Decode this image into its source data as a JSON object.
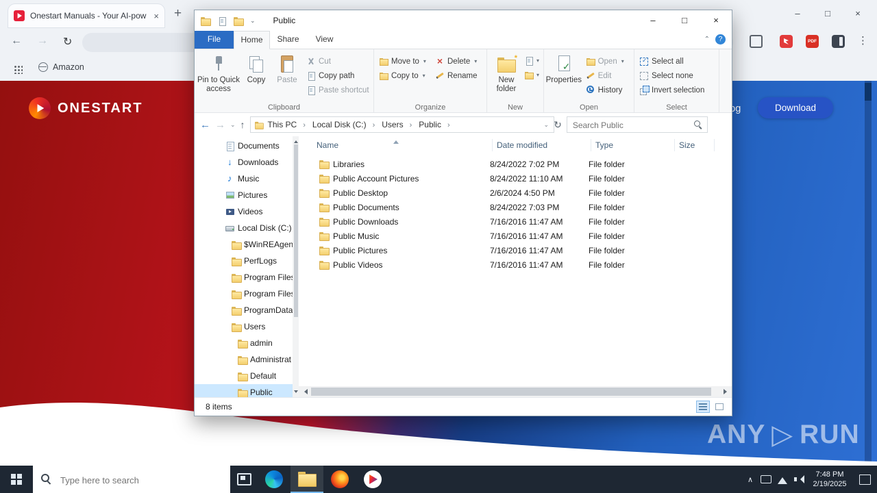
{
  "glyphs": {
    "close": "×",
    "min": "–",
    "max": "□",
    "plus": "+",
    "back": "←",
    "forward": "→",
    "refresh": "↻",
    "up": "↑",
    "caret_down": "⌄",
    "chevron_up": "⌃",
    "help": "?",
    "kebab": "⋮",
    "tray_chevron": "∧"
  },
  "browser": {
    "tab_title": "Onestart Manuals - Your AI-pow",
    "bookmark": "Amazon",
    "pdf_badge": "PDF"
  },
  "page": {
    "brand": "ONESTART",
    "nav_partial": "log",
    "download": "Download",
    "watermark_left": "ANY",
    "watermark_tri": "▷",
    "watermark_right": "RUN"
  },
  "explorer": {
    "title": "Public",
    "tabs": {
      "file": "File",
      "home": "Home",
      "share": "Share",
      "view": "View"
    },
    "ribbon": {
      "clipboard": {
        "label": "Clipboard",
        "pin": "Pin to Quick access",
        "copy": "Copy",
        "paste": "Paste",
        "cut": "Cut",
        "copy_path": "Copy path",
        "paste_shortcut": "Paste shortcut"
      },
      "organize": {
        "label": "Organize",
        "move_to": "Move to",
        "copy_to": "Copy to",
        "delete": "Delete",
        "rename": "Rename"
      },
      "new_group": {
        "label": "New",
        "new_folder": "New folder"
      },
      "open_group": {
        "label": "Open",
        "properties": "Properties",
        "open": "Open",
        "edit": "Edit",
        "history": "History"
      },
      "select_group": {
        "label": "Select",
        "all": "Select all",
        "none": "Select none",
        "invert": "Invert selection"
      }
    },
    "address": {
      "crumbs": [
        "This PC",
        "Local Disk (C:)",
        "Users",
        "Public"
      ],
      "search_placeholder": "Search Public"
    },
    "columns": [
      "Name",
      "Date modified",
      "Type",
      "Size"
    ],
    "nav": [
      {
        "label": "Documents",
        "icon": "doc",
        "lvl": 1
      },
      {
        "label": "Downloads",
        "icon": "down",
        "lvl": 1
      },
      {
        "label": "Music",
        "icon": "music",
        "lvl": 1
      },
      {
        "label": "Pictures",
        "icon": "pic",
        "lvl": 1
      },
      {
        "label": "Videos",
        "icon": "vid",
        "lvl": 1
      },
      {
        "label": "Local Disk (C:)",
        "icon": "disk",
        "lvl": 1
      },
      {
        "label": "$WinREAgent",
        "icon": "folder",
        "lvl": 2
      },
      {
        "label": "PerfLogs",
        "icon": "folder",
        "lvl": 2
      },
      {
        "label": "Program Files",
        "icon": "folder",
        "lvl": 2
      },
      {
        "label": "Program Files",
        "icon": "folder",
        "lvl": 2
      },
      {
        "label": "ProgramData",
        "icon": "folder",
        "lvl": 2
      },
      {
        "label": "Users",
        "icon": "folder",
        "lvl": 2
      },
      {
        "label": "admin",
        "icon": "folder",
        "lvl": 3
      },
      {
        "label": "Administrat",
        "icon": "folder",
        "lvl": 3
      },
      {
        "label": "Default",
        "icon": "folder",
        "lvl": 3
      },
      {
        "label": "Public",
        "icon": "folder",
        "lvl": 3,
        "sel": true
      }
    ],
    "rows": [
      {
        "name": "Libraries",
        "modified": "8/24/2022 7:02 PM",
        "type": "File folder"
      },
      {
        "name": "Public Account Pictures",
        "modified": "8/24/2022 11:10 AM",
        "type": "File folder"
      },
      {
        "name": "Public Desktop",
        "modified": "2/6/2024 4:50 PM",
        "type": "File folder"
      },
      {
        "name": "Public Documents",
        "modified": "8/24/2022 7:03 PM",
        "type": "File folder"
      },
      {
        "name": "Public Downloads",
        "modified": "7/16/2016 11:47 AM",
        "type": "File folder"
      },
      {
        "name": "Public Music",
        "modified": "7/16/2016 11:47 AM",
        "type": "File folder"
      },
      {
        "name": "Public Pictures",
        "modified": "7/16/2016 11:47 AM",
        "type": "File folder"
      },
      {
        "name": "Public Videos",
        "modified": "7/16/2016 11:47 AM",
        "type": "File folder"
      }
    ],
    "status": "8 items"
  },
  "taskbar": {
    "search_placeholder": "Type here to search",
    "time": "7:48 PM",
    "date": "2/19/2025"
  }
}
